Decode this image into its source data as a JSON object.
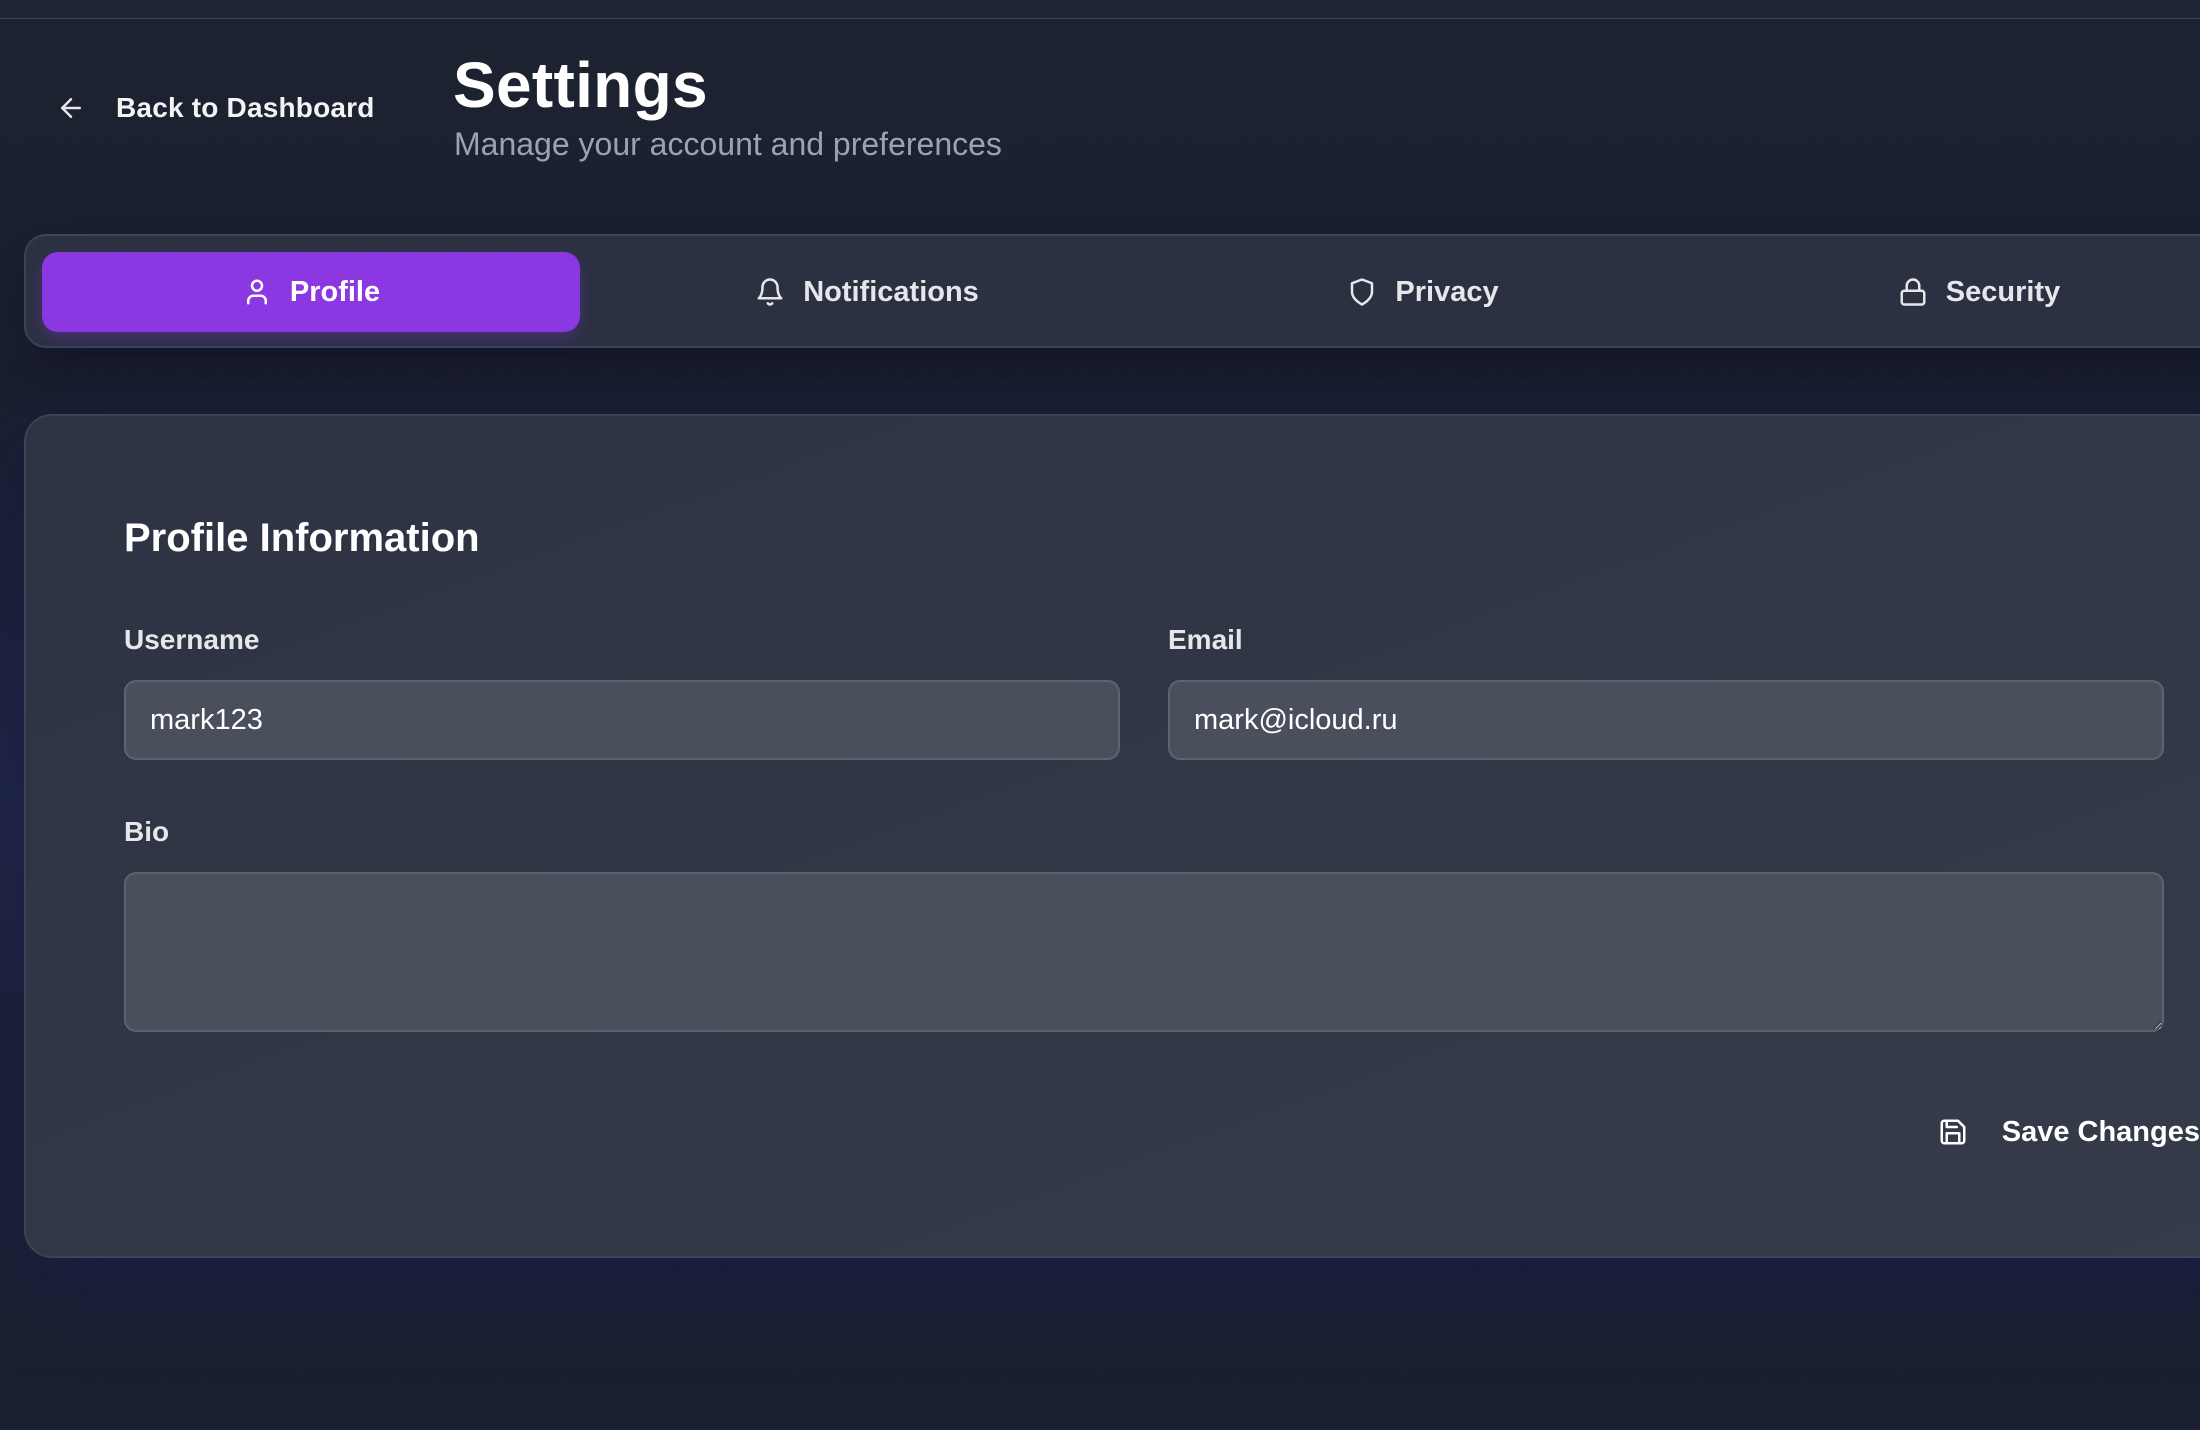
{
  "header": {
    "back_label": "Back to Dashboard",
    "title": "Settings",
    "subtitle": "Manage your account and preferences"
  },
  "tabs": [
    {
      "label": "Profile",
      "icon": "user-icon",
      "active": true
    },
    {
      "label": "Notifications",
      "icon": "bell-icon",
      "active": false
    },
    {
      "label": "Privacy",
      "icon": "shield-icon",
      "active": false
    },
    {
      "label": "Security",
      "icon": "lock-icon",
      "active": false
    }
  ],
  "profile": {
    "section_title": "Profile Information",
    "username": {
      "label": "Username",
      "value": "mark123"
    },
    "email": {
      "label": "Email",
      "value": "mark@icloud.ru"
    },
    "bio": {
      "label": "Bio",
      "value": ""
    },
    "save_label": "Save Changes"
  },
  "colors": {
    "accent": "#8b38e2",
    "background": "#1c2230",
    "card": "#323846",
    "input": "#4a4f5c",
    "muted_text": "#9aa3b2"
  }
}
